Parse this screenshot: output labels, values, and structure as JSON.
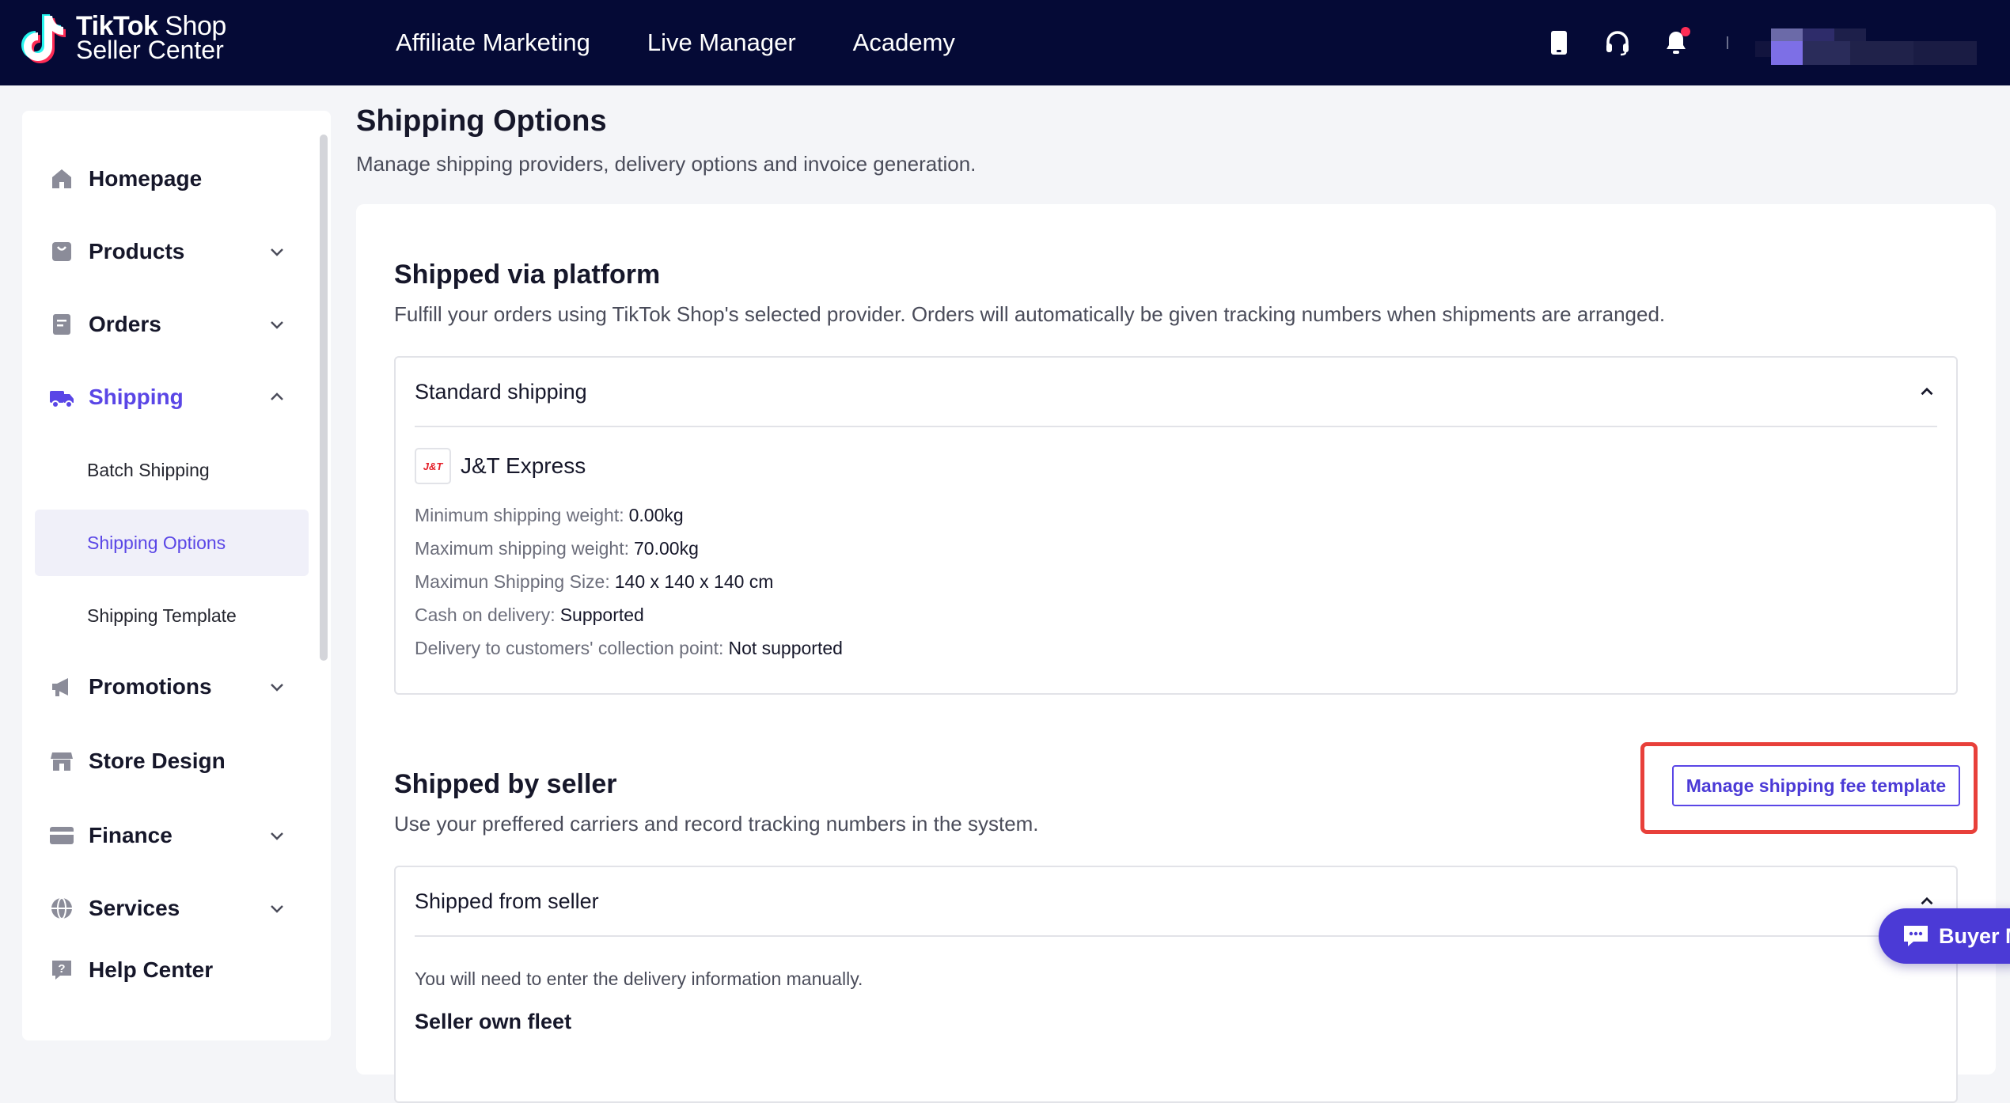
{
  "brand": {
    "name_bold": "TikTok",
    "name_light": " Shop",
    "subtitle": "Seller Center"
  },
  "topnav": [
    {
      "label": "Affiliate Marketing"
    },
    {
      "label": "Live Manager"
    },
    {
      "label": "Academy"
    }
  ],
  "topbar_icons": [
    "mobile-phone-icon",
    "headset-icon",
    "bell-icon"
  ],
  "sidebar": {
    "items": [
      {
        "label": "Homepage",
        "icon": "home-icon",
        "expandable": false
      },
      {
        "label": "Products",
        "icon": "bag-icon",
        "expandable": true
      },
      {
        "label": "Orders",
        "icon": "document-icon",
        "expandable": true
      },
      {
        "label": "Shipping",
        "icon": "truck-icon",
        "expandable": true,
        "expanded": true,
        "active": true
      },
      {
        "label": "Promotions",
        "icon": "megaphone-icon",
        "expandable": true
      },
      {
        "label": "Store Design",
        "icon": "store-icon",
        "expandable": false
      },
      {
        "label": "Finance",
        "icon": "card-icon",
        "expandable": true
      },
      {
        "label": "Services",
        "icon": "globe-icon",
        "expandable": true
      },
      {
        "label": "Help Center",
        "icon": "help-icon",
        "expandable": false
      }
    ],
    "shipping_sub": [
      {
        "label": "Batch Shipping"
      },
      {
        "label": "Shipping Options",
        "selected": true
      },
      {
        "label": "Shipping Template"
      }
    ]
  },
  "page": {
    "title": "Shipping Options",
    "subtitle": "Manage shipping providers, delivery options and invoice generation."
  },
  "platform": {
    "title": "Shipped via platform",
    "subtitle": "Fulfill your orders using TikTok Shop's selected provider. Orders will automatically be given tracking numbers when shipments are arranged.",
    "panel_title": "Standard shipping",
    "carrier_logo_text": "J&T",
    "carrier_name": "J&T Express",
    "specs": [
      {
        "key": "Minimum shipping weight:",
        "value": "0.00kg"
      },
      {
        "key": "Maximum shipping weight:",
        "value": "70.00kg"
      },
      {
        "key": "Maximun Shipping Size:",
        "value": "140 x 140 x 140 cm"
      },
      {
        "key": "Cash on delivery:",
        "value": "Supported"
      },
      {
        "key": "Delivery to customers' collection point:",
        "value": "Not supported"
      }
    ]
  },
  "seller": {
    "title": "Shipped by seller",
    "subtitle": "Use your preffered carriers and record tracking numbers in the system.",
    "button_label": "Manage shipping fee template",
    "panel_title": "Shipped from seller",
    "note": "You will need to enter the delivery information manually.",
    "fleet": "Seller own fleet"
  },
  "chat": {
    "label": "Buyer M"
  },
  "colors": {
    "topbar": "#050a36",
    "accent": "#5a46e6",
    "highlight": "#e8403a"
  }
}
